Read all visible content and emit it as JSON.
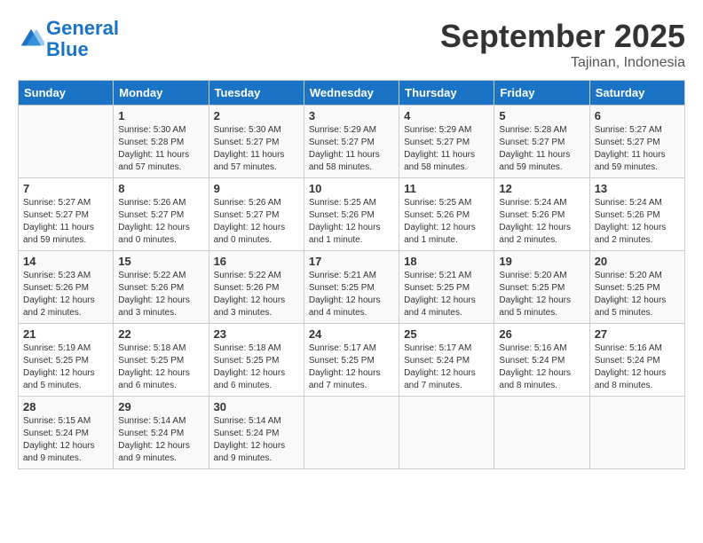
{
  "header": {
    "logo_line1": "General",
    "logo_line2": "Blue",
    "title": "September 2025",
    "subtitle": "Tajinan, Indonesia"
  },
  "columns": [
    "Sunday",
    "Monday",
    "Tuesday",
    "Wednesday",
    "Thursday",
    "Friday",
    "Saturday"
  ],
  "weeks": [
    [
      {
        "day": "",
        "info": ""
      },
      {
        "day": "1",
        "info": "Sunrise: 5:30 AM\nSunset: 5:28 PM\nDaylight: 11 hours\nand 57 minutes."
      },
      {
        "day": "2",
        "info": "Sunrise: 5:30 AM\nSunset: 5:27 PM\nDaylight: 11 hours\nand 57 minutes."
      },
      {
        "day": "3",
        "info": "Sunrise: 5:29 AM\nSunset: 5:27 PM\nDaylight: 11 hours\nand 58 minutes."
      },
      {
        "day": "4",
        "info": "Sunrise: 5:29 AM\nSunset: 5:27 PM\nDaylight: 11 hours\nand 58 minutes."
      },
      {
        "day": "5",
        "info": "Sunrise: 5:28 AM\nSunset: 5:27 PM\nDaylight: 11 hours\nand 59 minutes."
      },
      {
        "day": "6",
        "info": "Sunrise: 5:27 AM\nSunset: 5:27 PM\nDaylight: 11 hours\nand 59 minutes."
      }
    ],
    [
      {
        "day": "7",
        "info": "Sunrise: 5:27 AM\nSunset: 5:27 PM\nDaylight: 11 hours\nand 59 minutes."
      },
      {
        "day": "8",
        "info": "Sunrise: 5:26 AM\nSunset: 5:27 PM\nDaylight: 12 hours\nand 0 minutes."
      },
      {
        "day": "9",
        "info": "Sunrise: 5:26 AM\nSunset: 5:27 PM\nDaylight: 12 hours\nand 0 minutes."
      },
      {
        "day": "10",
        "info": "Sunrise: 5:25 AM\nSunset: 5:26 PM\nDaylight: 12 hours\nand 1 minute."
      },
      {
        "day": "11",
        "info": "Sunrise: 5:25 AM\nSunset: 5:26 PM\nDaylight: 12 hours\nand 1 minute."
      },
      {
        "day": "12",
        "info": "Sunrise: 5:24 AM\nSunset: 5:26 PM\nDaylight: 12 hours\nand 2 minutes."
      },
      {
        "day": "13",
        "info": "Sunrise: 5:24 AM\nSunset: 5:26 PM\nDaylight: 12 hours\nand 2 minutes."
      }
    ],
    [
      {
        "day": "14",
        "info": "Sunrise: 5:23 AM\nSunset: 5:26 PM\nDaylight: 12 hours\nand 2 minutes."
      },
      {
        "day": "15",
        "info": "Sunrise: 5:22 AM\nSunset: 5:26 PM\nDaylight: 12 hours\nand 3 minutes."
      },
      {
        "day": "16",
        "info": "Sunrise: 5:22 AM\nSunset: 5:26 PM\nDaylight: 12 hours\nand 3 minutes."
      },
      {
        "day": "17",
        "info": "Sunrise: 5:21 AM\nSunset: 5:25 PM\nDaylight: 12 hours\nand 4 minutes."
      },
      {
        "day": "18",
        "info": "Sunrise: 5:21 AM\nSunset: 5:25 PM\nDaylight: 12 hours\nand 4 minutes."
      },
      {
        "day": "19",
        "info": "Sunrise: 5:20 AM\nSunset: 5:25 PM\nDaylight: 12 hours\nand 5 minutes."
      },
      {
        "day": "20",
        "info": "Sunrise: 5:20 AM\nSunset: 5:25 PM\nDaylight: 12 hours\nand 5 minutes."
      }
    ],
    [
      {
        "day": "21",
        "info": "Sunrise: 5:19 AM\nSunset: 5:25 PM\nDaylight: 12 hours\nand 5 minutes."
      },
      {
        "day": "22",
        "info": "Sunrise: 5:18 AM\nSunset: 5:25 PM\nDaylight: 12 hours\nand 6 minutes."
      },
      {
        "day": "23",
        "info": "Sunrise: 5:18 AM\nSunset: 5:25 PM\nDaylight: 12 hours\nand 6 minutes."
      },
      {
        "day": "24",
        "info": "Sunrise: 5:17 AM\nSunset: 5:25 PM\nDaylight: 12 hours\nand 7 minutes."
      },
      {
        "day": "25",
        "info": "Sunrise: 5:17 AM\nSunset: 5:24 PM\nDaylight: 12 hours\nand 7 minutes."
      },
      {
        "day": "26",
        "info": "Sunrise: 5:16 AM\nSunset: 5:24 PM\nDaylight: 12 hours\nand 8 minutes."
      },
      {
        "day": "27",
        "info": "Sunrise: 5:16 AM\nSunset: 5:24 PM\nDaylight: 12 hours\nand 8 minutes."
      }
    ],
    [
      {
        "day": "28",
        "info": "Sunrise: 5:15 AM\nSunset: 5:24 PM\nDaylight: 12 hours\nand 9 minutes."
      },
      {
        "day": "29",
        "info": "Sunrise: 5:14 AM\nSunset: 5:24 PM\nDaylight: 12 hours\nand 9 minutes."
      },
      {
        "day": "30",
        "info": "Sunrise: 5:14 AM\nSunset: 5:24 PM\nDaylight: 12 hours\nand 9 minutes."
      },
      {
        "day": "",
        "info": ""
      },
      {
        "day": "",
        "info": ""
      },
      {
        "day": "",
        "info": ""
      },
      {
        "day": "",
        "info": ""
      }
    ]
  ]
}
